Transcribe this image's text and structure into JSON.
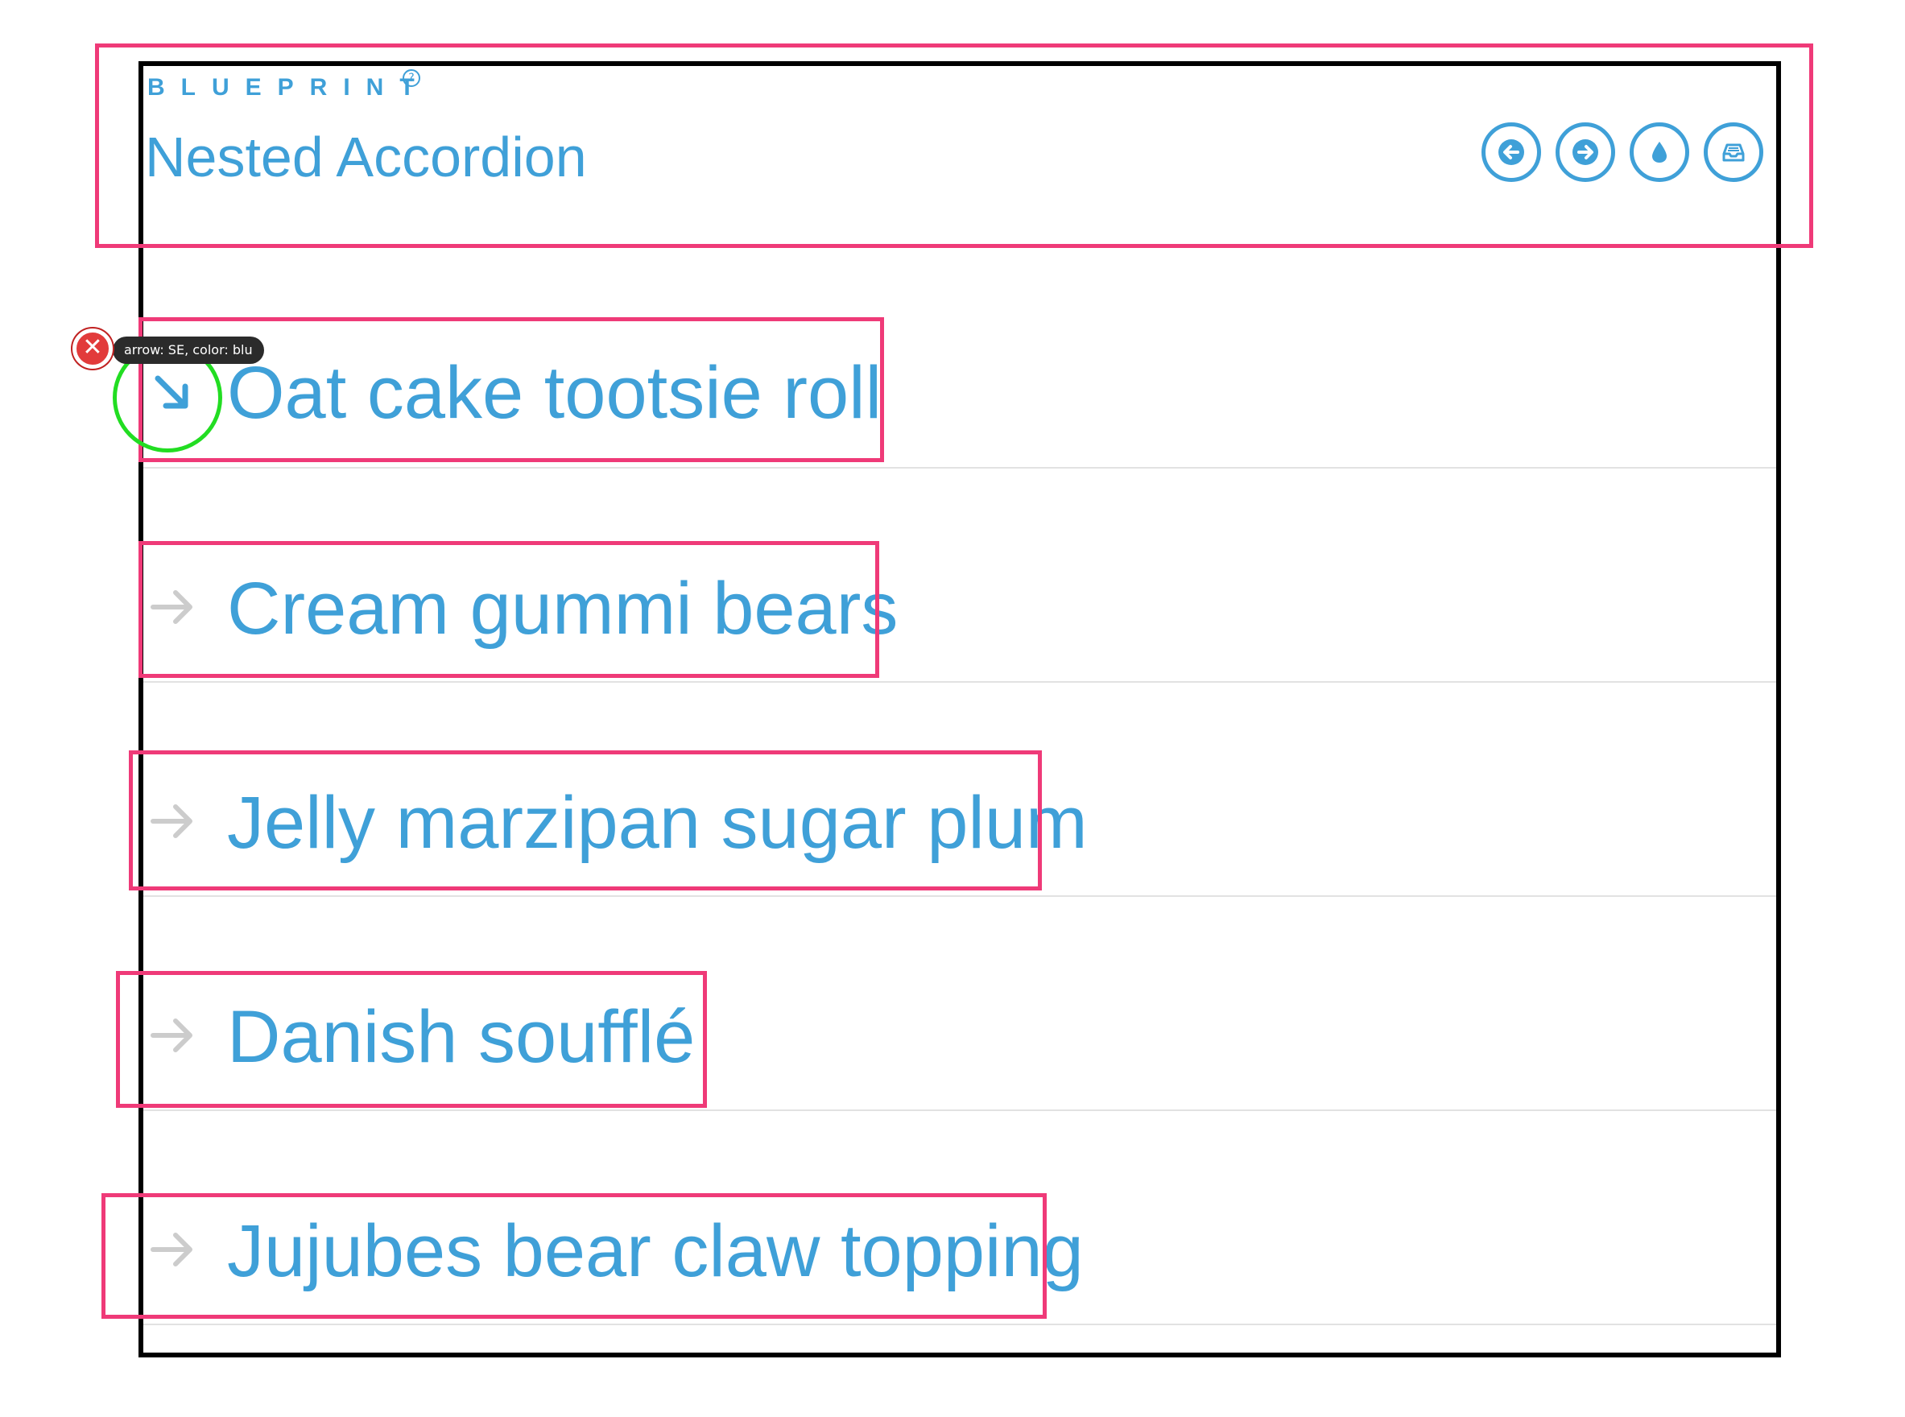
{
  "header": {
    "brand": "BLUEPRINT",
    "brand_mark": "?",
    "title": "Nested Accordion",
    "toolbar": [
      {
        "name": "back-button",
        "icon": "arrow-left-icon"
      },
      {
        "name": "forward-button",
        "icon": "arrow-right-icon"
      },
      {
        "name": "color-button",
        "icon": "droplet-icon"
      },
      {
        "name": "inbox-button",
        "icon": "inbox-icon"
      }
    ]
  },
  "accordion": {
    "items": [
      {
        "label": "Oat cake tootsie roll",
        "arrow": "arrow-se-icon",
        "active": true
      },
      {
        "label": "Cream gummi bears",
        "arrow": "arrow-right-icon",
        "active": false
      },
      {
        "label": "Jelly marzipan sugar plum",
        "arrow": "arrow-right-icon",
        "active": false
      },
      {
        "label": "Danish soufflé",
        "arrow": "arrow-right-icon",
        "active": false
      },
      {
        "label": "Jujubes bear claw topping",
        "arrow": "arrow-right-icon",
        "active": false
      }
    ]
  },
  "annotation": {
    "tooltip": "arrow:  SE, color: blu",
    "close_glyph": "✕"
  },
  "colors": {
    "accent": "#3fa0d8",
    "muted_arrow": "#cccccc",
    "annotation_box": "#ef3a78",
    "highlight_circle": "#22dd22"
  }
}
